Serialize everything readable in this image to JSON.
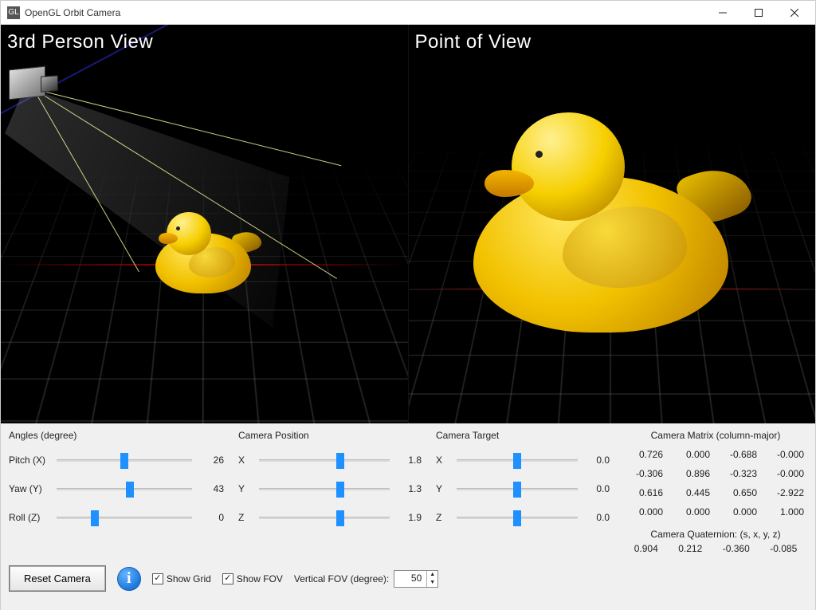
{
  "window": {
    "title": "OpenGL Orbit Camera"
  },
  "viewports": {
    "left_label": "3rd Person View",
    "right_label": "Point of View"
  },
  "angles": {
    "section_label": "Angles (degree)",
    "pitch_label": "Pitch (X)",
    "pitch_value": "26",
    "yaw_label": "Yaw (Y)",
    "yaw_value": "43",
    "roll_label": "Roll (Z)",
    "roll_value": "0"
  },
  "camera_position": {
    "section_label": "Camera Position",
    "x_label": "X",
    "x_value": "1.8",
    "y_label": "Y",
    "y_value": "1.3",
    "z_label": "Z",
    "z_value": "1.9"
  },
  "camera_target": {
    "section_label": "Camera Target",
    "x_label": "X",
    "x_value": "0.0",
    "y_label": "Y",
    "y_value": "0.0",
    "z_label": "Z",
    "z_value": "0.0"
  },
  "matrix": {
    "title": "Camera Matrix (column-major)",
    "cells": {
      "r0c0": "0.726",
      "r0c1": "0.000",
      "r0c2": "-0.688",
      "r0c3": "-0.000",
      "r1c0": "-0.306",
      "r1c1": "0.896",
      "r1c2": "-0.323",
      "r1c3": "-0.000",
      "r2c0": "0.616",
      "r2c1": "0.445",
      "r2c2": "0.650",
      "r2c3": "-2.922",
      "r3c0": "0.000",
      "r3c1": "0.000",
      "r3c2": "0.000",
      "r3c3": "1.000"
    }
  },
  "bottom": {
    "reset_label": "Reset Camera",
    "show_grid_label": "Show Grid",
    "show_fov_label": "Show FOV",
    "vfov_label": "Vertical FOV (degree):",
    "vfov_value": "50"
  },
  "quaternion": {
    "title": "Camera Quaternion: (s, x, y, z)",
    "s": "0.904",
    "x": "0.212",
    "y": "-0.360",
    "z": "-0.085"
  }
}
